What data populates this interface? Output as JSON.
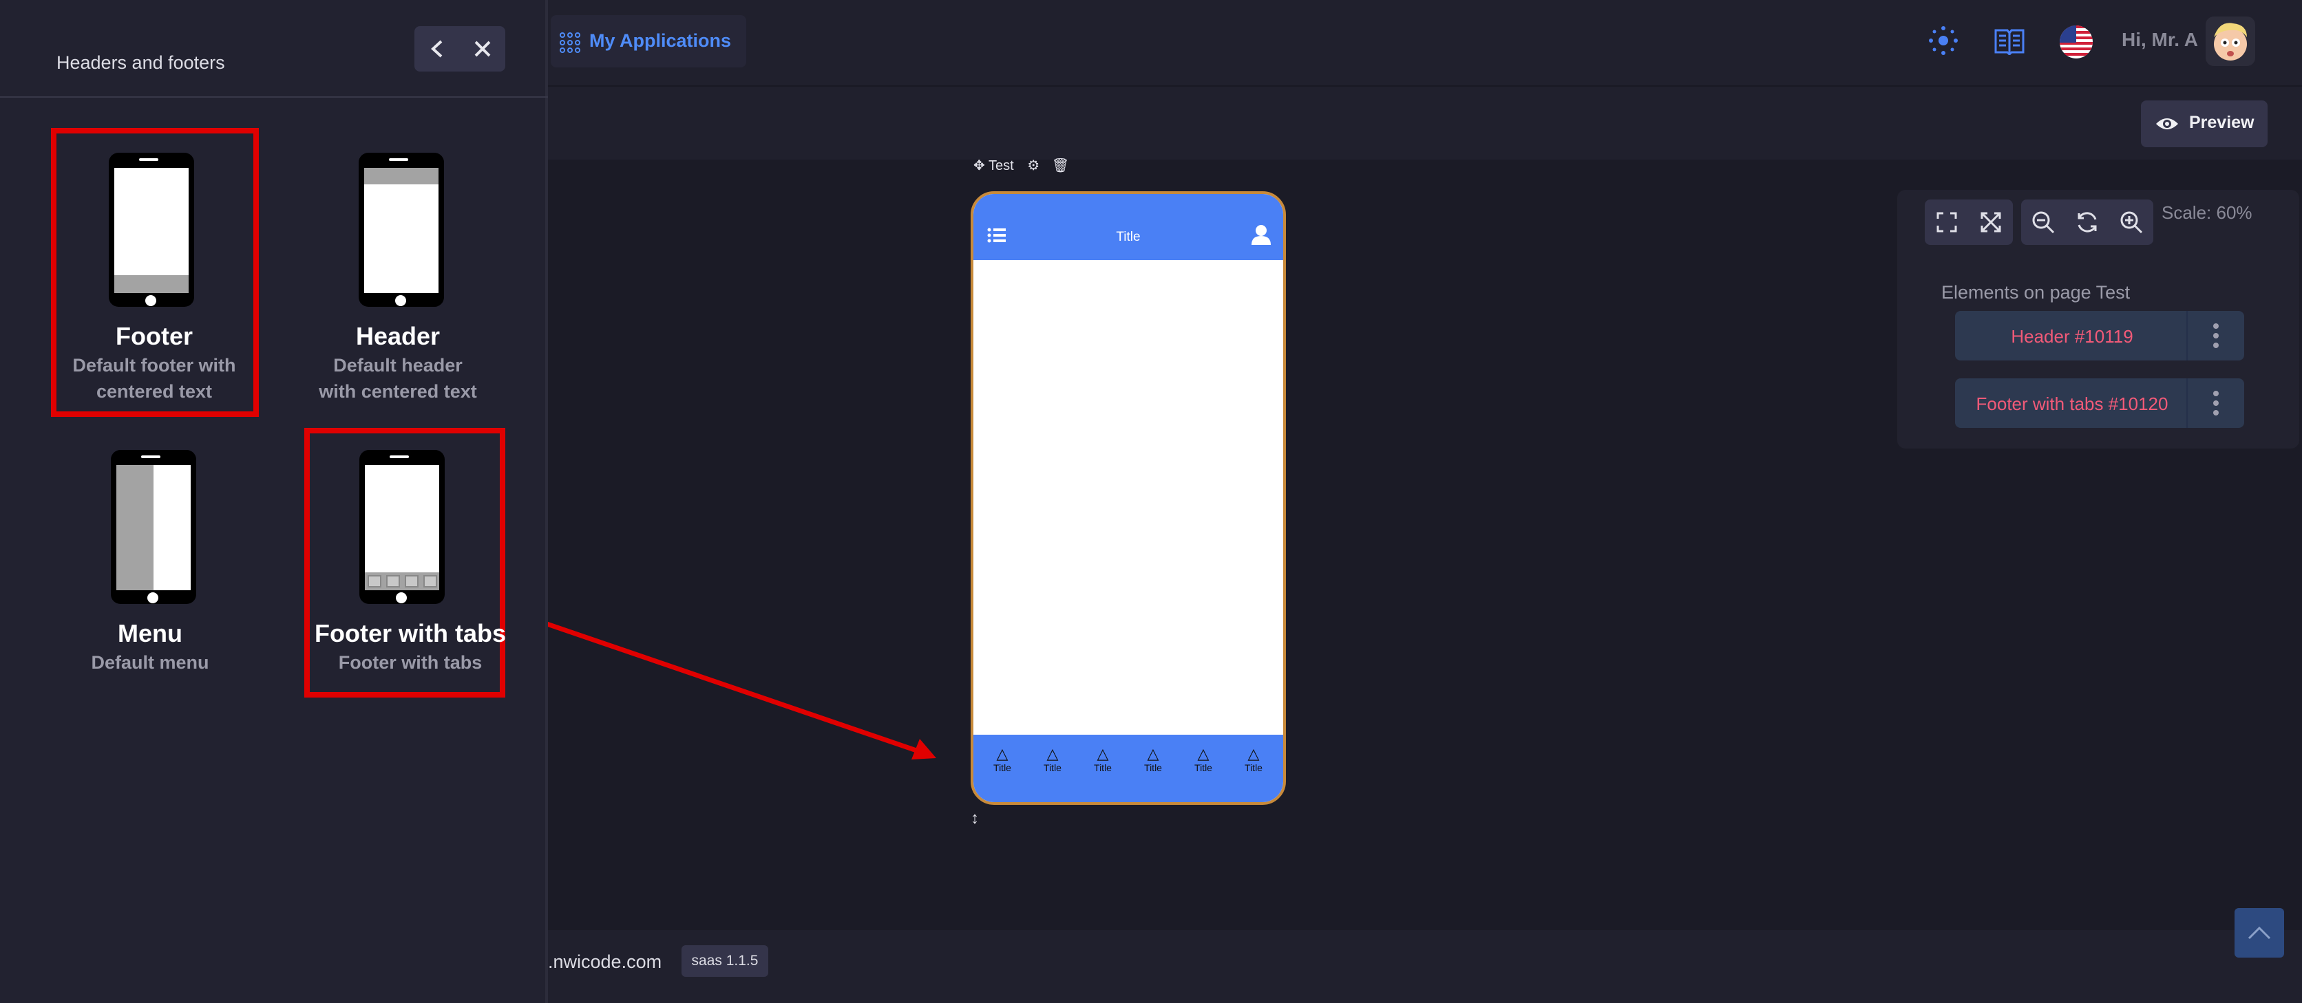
{
  "topbar": {
    "my_apps_label": "My Applications",
    "greeting": "Hi, Mr. A",
    "preview_label": "Preview"
  },
  "panel": {
    "title": "Headers and footers",
    "back_icon": "chevron-left-icon",
    "close_icon": "close-icon",
    "cards": [
      {
        "name": "Footer",
        "desc": "Default footer with centered text"
      },
      {
        "name": "Header",
        "desc": "Default header with centered text"
      },
      {
        "name": "Menu",
        "desc": "Default menu"
      },
      {
        "name": "Footer with tabs",
        "desc": "Footer with tabs"
      }
    ]
  },
  "canvas": {
    "page_name": "Test",
    "header_title": "Title",
    "tabs": [
      "Title",
      "Title",
      "Title",
      "Title",
      "Title",
      "Title"
    ]
  },
  "right_panel": {
    "scale": "Scale: 60%",
    "elements_label": "Elements on page Test",
    "elements": [
      "Header #10119",
      "Footer with tabs #10120"
    ]
  },
  "footer": {
    "domain": ".nwicode.com",
    "version": "saas 1.1.5"
  },
  "colors": {
    "accent": "#4a80f5",
    "highlight": "#e00000",
    "element_text": "#f25a78"
  }
}
